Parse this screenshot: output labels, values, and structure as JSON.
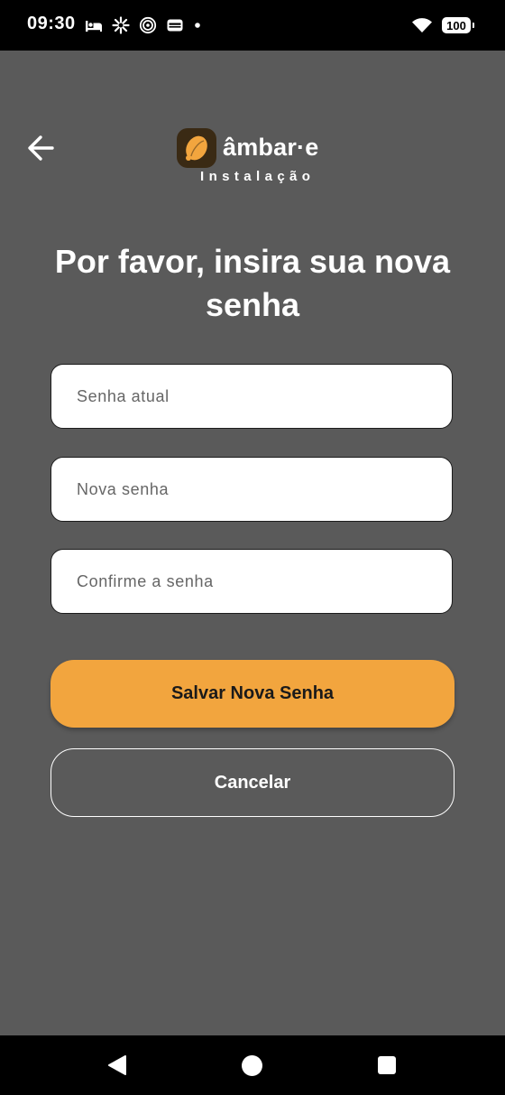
{
  "status_bar": {
    "time": "09:30",
    "battery": "100",
    "icons": [
      "bed-icon",
      "pinwheel-icon",
      "spiral-icon",
      "wallet-icon",
      "dot-icon",
      "wifi-icon",
      "battery-icon"
    ]
  },
  "header": {
    "back_icon": "arrow-left-icon",
    "logo_text": "âmbar·e",
    "subtitle": "Instalação"
  },
  "form": {
    "title": "Por favor, insira sua nova senha",
    "current_password_placeholder": "Senha atual",
    "new_password_placeholder": "Nova senha",
    "confirm_password_placeholder": "Confirme a senha"
  },
  "actions": {
    "save_label": "Salvar Nova Senha",
    "cancel_label": "Cancelar"
  },
  "colors": {
    "background": "#5a5a5a",
    "accent": "#f2a53e",
    "logo_mark": "#3a2a14"
  },
  "nav_bar": {
    "icons": [
      "nav-back-icon",
      "nav-home-icon",
      "nav-recents-icon"
    ]
  }
}
